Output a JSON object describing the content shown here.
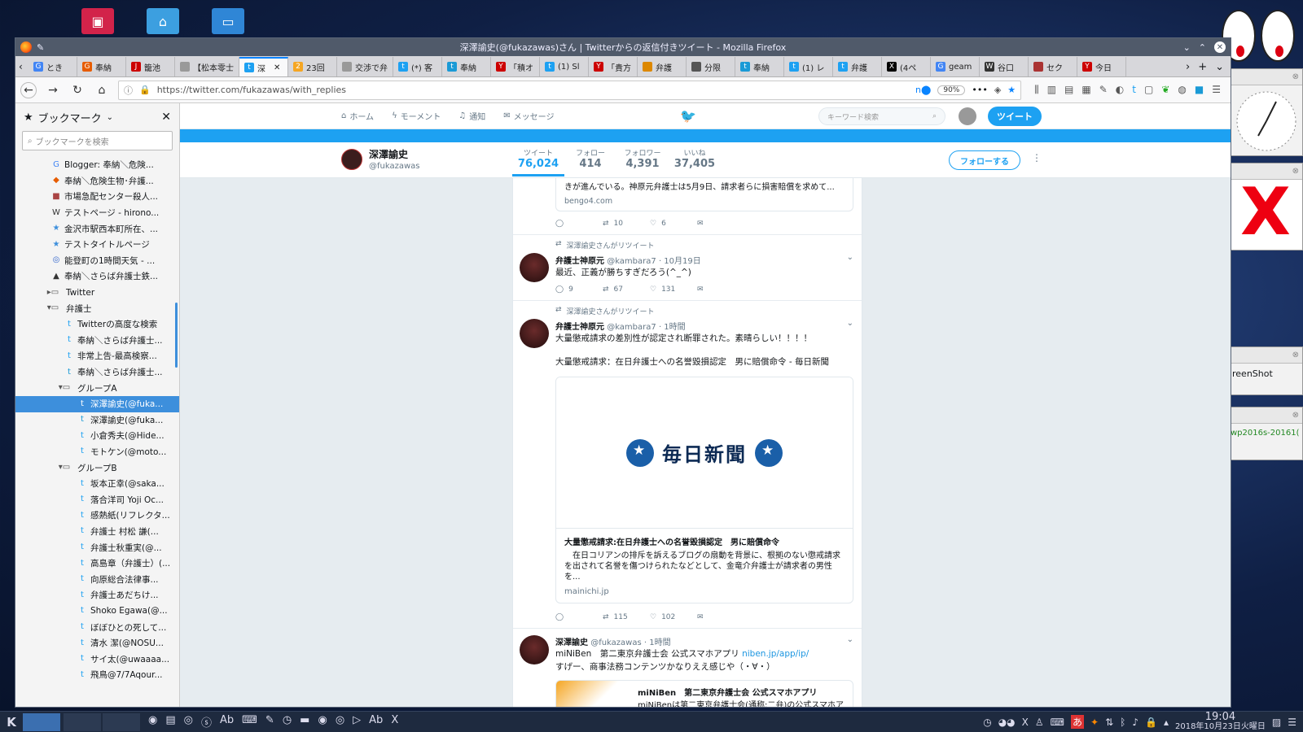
{
  "window": {
    "title": "深澤諭史(@fukazawas)さん | Twitterからの返信付きツイート - Mozilla Firefox"
  },
  "tabs": [
    {
      "label": "とき",
      "fav": "G",
      "color": "#4285f4"
    },
    {
      "label": "奉納",
      "fav": "G",
      "color": "#e65c00"
    },
    {
      "label": "籠池",
      "fav": "J",
      "color": "#c00"
    },
    {
      "label": "【松本零士",
      "fav": "",
      "color": "#999"
    },
    {
      "label": "深",
      "fav": "t",
      "color": "#1da1f2",
      "active": true
    },
    {
      "label": "23回",
      "fav": "2",
      "color": "#f5a623"
    },
    {
      "label": "交渉で弁",
      "fav": "",
      "color": "#999"
    },
    {
      "label": "(*) 客",
      "fav": "t",
      "color": "#1da1f2"
    },
    {
      "label": "奉納",
      "fav": "t",
      "color": "#1a9ad6"
    },
    {
      "label": "「積オ",
      "fav": "Y",
      "color": "#c00"
    },
    {
      "label": "(1) Sl",
      "fav": "t",
      "color": "#1da1f2"
    },
    {
      "label": "「貴方",
      "fav": "Y",
      "color": "#c00"
    },
    {
      "label": "弁護",
      "fav": "",
      "color": "#d80"
    },
    {
      "label": "分限",
      "fav": "",
      "color": "#555"
    },
    {
      "label": "奉納",
      "fav": "t",
      "color": "#1a9ad6"
    },
    {
      "label": "(1) レ",
      "fav": "t",
      "color": "#1da1f2"
    },
    {
      "label": "弁護",
      "fav": "t",
      "color": "#1da1f2"
    },
    {
      "label": "(4ペ",
      "fav": "X",
      "color": "#000"
    },
    {
      "label": "geam",
      "fav": "G",
      "color": "#4285f4"
    },
    {
      "label": "谷口",
      "fav": "W",
      "color": "#333"
    },
    {
      "label": "セク",
      "fav": "",
      "color": "#a33"
    },
    {
      "label": "今日",
      "fav": "Y",
      "color": "#c00"
    }
  ],
  "navbar": {
    "url": "https://twitter.com/fukazawas/with_replies",
    "zoom": "90%"
  },
  "sidebar": {
    "title": "ブックマーク",
    "search_placeholder": "ブックマークを検索",
    "items": [
      {
        "label": "Blogger: 奉納＼危険...",
        "icon": "G",
        "indent": 44,
        "color": "#4285f4"
      },
      {
        "label": "奉納＼危険生物･弁護...",
        "icon": "◆",
        "indent": 44,
        "color": "#e65c00"
      },
      {
        "label": "市場急配センター殺人...",
        "icon": "■",
        "indent": 44,
        "color": "#a44"
      },
      {
        "label": "テストページ - hirono...",
        "icon": "W",
        "indent": 44,
        "color": "#333"
      },
      {
        "label": "金沢市駅西本町所在、...",
        "icon": "★",
        "indent": 44,
        "color": "#3d8fdc"
      },
      {
        "label": "テストタイトルページ",
        "icon": "★",
        "indent": 44,
        "color": "#3d8fdc"
      },
      {
        "label": "能登町の1時間天気 - ...",
        "icon": "◎",
        "indent": 44,
        "color": "#36c"
      },
      {
        "label": "奉納＼さらば弁護士鉄...",
        "icon": "▲",
        "indent": 44,
        "color": "#333"
      },
      {
        "label": "Twitter",
        "icon": "▸▭",
        "indent": 34,
        "color": "#555"
      },
      {
        "label": "弁護士",
        "icon": "▾▭",
        "indent": 34,
        "color": "#555"
      },
      {
        "label": "Twitterの高度な検索",
        "icon": "t",
        "indent": 60,
        "color": "#1da1f2"
      },
      {
        "label": "奉納＼さらば弁護士...",
        "icon": "t",
        "indent": 60,
        "color": "#1da1f2"
      },
      {
        "label": "非常上告-最高検察...",
        "icon": "t",
        "indent": 60,
        "color": "#1da1f2"
      },
      {
        "label": "奉納＼さらば弁護士...",
        "icon": "t",
        "indent": 60,
        "color": "#1a9ad6"
      },
      {
        "label": "グループA",
        "icon": "▾▭",
        "indent": 48,
        "color": "#555"
      },
      {
        "label": "深澤諭史(@fuka...",
        "icon": "t",
        "indent": 76,
        "color": "#1da1f2",
        "selected": true
      },
      {
        "label": "深澤諭史(@fuka...",
        "icon": "t",
        "indent": 76,
        "color": "#1a9ad6"
      },
      {
        "label": "小倉秀夫(@Hide...",
        "icon": "t",
        "indent": 76,
        "color": "#1da1f2"
      },
      {
        "label": "モトケン(@moto...",
        "icon": "t",
        "indent": 76,
        "color": "#1da1f2"
      },
      {
        "label": "グループB",
        "icon": "▾▭",
        "indent": 48,
        "color": "#555"
      },
      {
        "label": "坂本正幸(@saka...",
        "icon": "t",
        "indent": 76,
        "color": "#1da1f2"
      },
      {
        "label": "落合洋司 Yoji Oc...",
        "icon": "t",
        "indent": 76,
        "color": "#1da1f2"
      },
      {
        "label": "感熱紙(リフレクタ...",
        "icon": "t",
        "indent": 76,
        "color": "#1da1f2"
      },
      {
        "label": "弁護士 村松 謙(...",
        "icon": "t",
        "indent": 76,
        "color": "#1da1f2"
      },
      {
        "label": "弁護士秋重実(@...",
        "icon": "t",
        "indent": 76,
        "color": "#1da1f2"
      },
      {
        "label": "高島章（弁護士）(...",
        "icon": "t",
        "indent": 76,
        "color": "#1da1f2"
      },
      {
        "label": "向原総合法律事...",
        "icon": "t",
        "indent": 76,
        "color": "#1da1f2"
      },
      {
        "label": "弁護士あだちけ...",
        "icon": "t",
        "indent": 76,
        "color": "#1da1f2"
      },
      {
        "label": "Shoko Egawa(@...",
        "icon": "t",
        "indent": 76,
        "color": "#1da1f2"
      },
      {
        "label": "ぼぼひとの死して...",
        "icon": "t",
        "indent": 76,
        "color": "#1da1f2"
      },
      {
        "label": "清水 潔(@NOSU...",
        "icon": "t",
        "indent": 76,
        "color": "#1da1f2"
      },
      {
        "label": "サイ太(@uwaaaa...",
        "icon": "t",
        "indent": 76,
        "color": "#1da1f2"
      },
      {
        "label": "飛鳥@7/7Aqour...",
        "icon": "t",
        "indent": 76,
        "color": "#1da1f2"
      }
    ]
  },
  "twitter": {
    "nav": {
      "home": "ホーム",
      "moments": "モーメント",
      "notifications": "通知",
      "messages": "メッセージ"
    },
    "search_placeholder": "キーワード検索",
    "tweet_button": "ツイート",
    "profile": {
      "name": "深澤諭史",
      "handle": "@fukazawas",
      "follow_button": "フォローする",
      "stats": [
        {
          "label": "ツイート",
          "value": "76,024",
          "active": true
        },
        {
          "label": "フォロー",
          "value": "414"
        },
        {
          "label": "フォロワー",
          "value": "4,391"
        },
        {
          "label": "いいね",
          "value": "37,405"
        }
      ]
    },
    "card_tail": {
      "text": "きが進んでいる。神原元弁護士は5月9日、請求者らに損害賠償を求めて...",
      "domain": "bengo4.com",
      "actions": {
        "reply": "",
        "retweet": "10",
        "like": "6"
      }
    },
    "tweet1": {
      "rt_by": "深澤諭史さんがリツイート",
      "name": "弁護士神原元",
      "handle": "@kambara7",
      "time": "· 10月19日",
      "text": "最近、正義が勝ちすぎだろう(^_^)",
      "actions": {
        "reply": "9",
        "retweet": "67",
        "like": "131"
      }
    },
    "tweet2": {
      "rt_by": "深澤諭史さんがリツイート",
      "name": "弁護士神原元",
      "handle": "@kambara7",
      "time": "· 1時間",
      "text1": "大量懲戒請求の差別性が認定され断罪された。素晴らしい！！！！",
      "text2": "大量懲戒請求：在日弁護士への名誉毀損認定　男に賠償命令 - 毎日新聞",
      "card_logo": "毎日新聞",
      "card_title": "大量懲戒請求:在日弁護士への名誉毀損認定　男に賠償命令",
      "card_desc": "　在日コリアンの排斥を訴えるブログの扇動を背景に、根拠のない懲戒請求を出されて名誉を傷つけられたなどとして、金竜介弁護士が請求者の男性を...",
      "card_domain": "mainichi.jp",
      "actions": {
        "reply": "",
        "retweet": "115",
        "like": "102"
      }
    },
    "tweet3": {
      "name": "深澤諭史",
      "handle": "@fukazawas",
      "time": "· 1時間",
      "text_a": "miNiBen　第二東京弁護士会 公式スマホアプリ ",
      "link": "niben.jp/app/ip/",
      "text_b": "すげー、商事法務コンテンツかなりええ感じや（・∀・）",
      "card_title": "miNiBen　第二東京弁護士会 公式スマホアプリ",
      "card_desc": "miNiBenは第二東京弁護士会(通称:二弁)の公式スマホア"
    }
  },
  "widgets": {
    "screenshot_label": "reenShot",
    "file_label": "wp2016s-20161("
  },
  "taskbar": {
    "time": "19:04",
    "date": "2018年10月23日火曜日"
  }
}
